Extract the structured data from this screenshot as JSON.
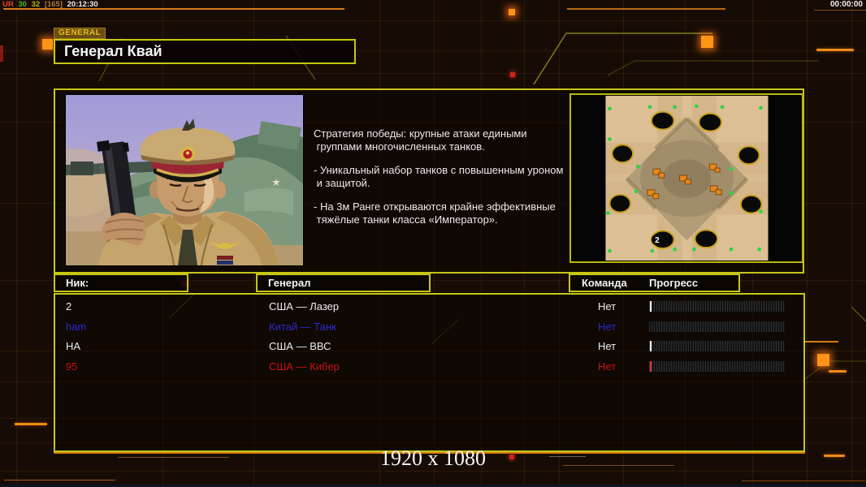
{
  "topbar": {
    "net_stats": [
      {
        "label": "UR",
        "color": "#e04228"
      },
      {
        "label": "30",
        "color": "#46b832"
      },
      {
        "label": "32",
        "color": "#b4b428"
      },
      {
        "label": "[165]",
        "color": "#a87838"
      },
      {
        "label": "20:12:30",
        "color": "#ececec"
      }
    ],
    "match_timer": "00:00:00"
  },
  "header": {
    "tab_label": "GENERAL",
    "title": "Генерал Квай"
  },
  "briefing": {
    "paragraphs": [
      "Стратегия победы: крупные атаки едиными\n группами многочисленных танков.",
      "- Уникальный набор танков с повышенным уроном\n и защитой.",
      "- На 3м Ранге открываются крайне эффективные\n тяжёлые танки класса «Император»."
    ],
    "map_start_marker": "2"
  },
  "players_table": {
    "headers": {
      "nick": "Ник:",
      "general": "Генерал",
      "team": "Команда",
      "progress": "Прогресс"
    },
    "rows": [
      {
        "nick": "2",
        "general": "США — Лазер",
        "team": "Нет",
        "color": "#ededed",
        "cursor": "#f2f2f2",
        "progress_pct": 0
      },
      {
        "nick": "ham",
        "general": "Китай — Танк",
        "team": "Нет",
        "color": "#2b2bcf",
        "cursor": "none",
        "progress_pct": 0
      },
      {
        "nick": "НА",
        "general": "США — ВВС",
        "team": "Нет",
        "color": "#ededed",
        "cursor": "#f2f2f2",
        "progress_pct": 0
      },
      {
        "nick": "95",
        "general": "США — Кибер",
        "team": "Нет",
        "color": "#c81212",
        "cursor": "#e03434",
        "progress_pct": 0
      }
    ]
  },
  "footer": {
    "resolution": "1920 x 1080"
  },
  "colors": {
    "frame_yellow": "#c6c617",
    "accent_orange": "#e8821a",
    "background": "#170c05"
  }
}
